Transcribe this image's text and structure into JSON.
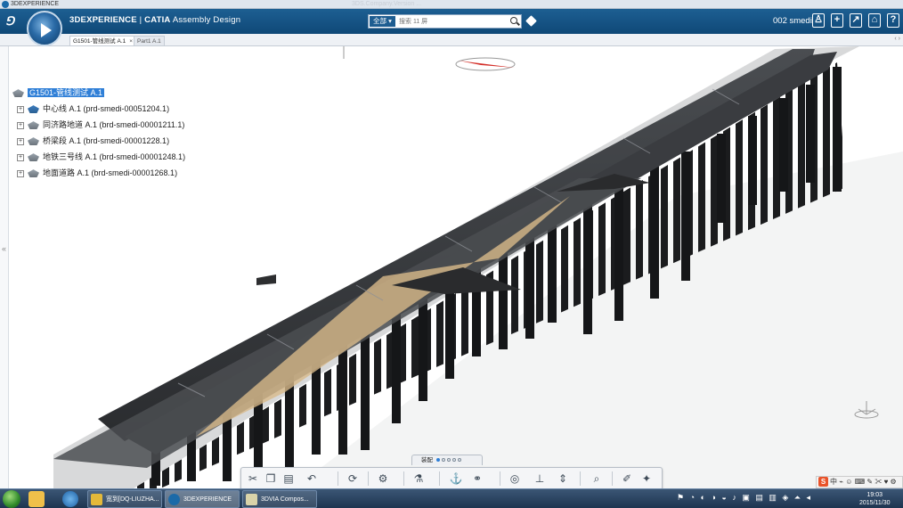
{
  "window": {
    "title": "3DEXPERIENCE",
    "ghost_title": "3DS.Company.Version ..."
  },
  "header": {
    "brand": "3DEXPERIENCE",
    "separator": " | ",
    "product": "CATIA",
    "app": "Assembly Design",
    "search": {
      "scope": "全部 ▾",
      "placeholder": "搜索 11 屏"
    },
    "user": "002 smedi",
    "buttons": [
      "user-icon",
      "plus-icon",
      "share-icon",
      "home-icon",
      "help-icon"
    ]
  },
  "tabs": [
    {
      "label": "G1501-管线测试 A.1",
      "close": "×",
      "active": true
    },
    {
      "label": "Part1 A.1",
      "active": false
    }
  ],
  "tree": {
    "root": {
      "label": "G1501-管线测试 A.1"
    },
    "children": [
      {
        "label": "中心线 A.1 (prd-smedi-00051204.1)"
      },
      {
        "label": "同济路地道 A.1 (brd-smedi-00001211.1)"
      },
      {
        "label": "桥梁段 A.1 (brd-smedi-00001228.1)"
      },
      {
        "label": "地铁三号线 A.1 (brd-smedi-00001248.1)"
      },
      {
        "label": "地面道路 A.1 (brd-smedi-00001268.1)"
      }
    ],
    "expander": "+"
  },
  "action_bar": {
    "tab_label": "装配",
    "tools": [
      "cut-icon",
      "copy-icon",
      "paste-icon",
      "undo-icon",
      "update-icon",
      "assembly-icon",
      "insert-icon",
      "fix-icon",
      "constraint-icon",
      "snap-icon",
      "axis-icon",
      "compass-icon",
      "zoom-icon",
      "measure-icon",
      "explode-icon"
    ]
  },
  "ime": {
    "badge": "S",
    "text": "中 ⌁ ☺ ⌨ ✎ ✂ ♥ ⚙"
  },
  "taskbar": {
    "tasks": [
      {
        "label": "宽到[DQ-LIUZHA...",
        "color": "#e4b93a"
      },
      {
        "label": "3DEXPERIENCE",
        "color": "#1c6aa8",
        "active": true
      },
      {
        "label": "3DVIA Compos...",
        "color": "#e8e4c8"
      }
    ],
    "tray": "⚑ ◔ ◐ ◑ ◒ ♪ ▣ ▤ ▥ ◈ ⏶ ◂",
    "time": "19:03",
    "date": "2015/11/30"
  }
}
